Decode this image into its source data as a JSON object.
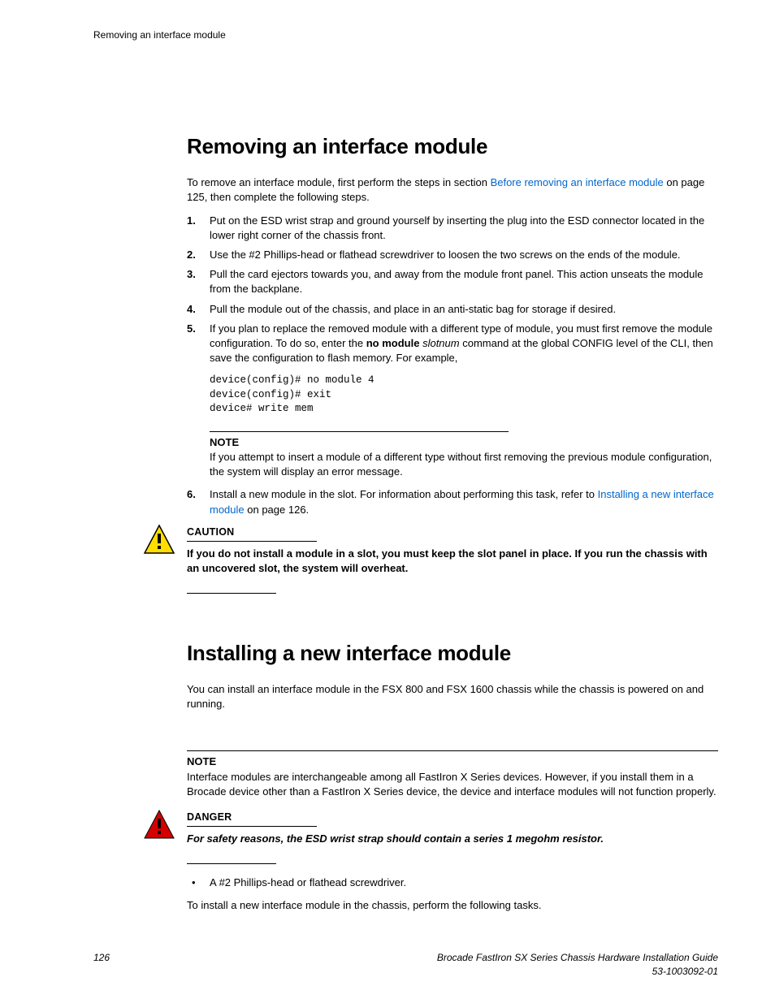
{
  "header": {
    "running": "Removing an interface module"
  },
  "section1": {
    "title": "Removing an interface module",
    "intro_a": "To remove an interface module, first perform the steps in section ",
    "intro_link": "Before removing an interface module",
    "intro_b": " on page 125, then complete the following steps.",
    "steps": [
      "Put on the ESD wrist strap and ground yourself by inserting the plug into the ESD connector located in the lower right corner of the chassis front.",
      "Use the #2 Phillips-head or flathead screwdriver to loosen the two screws on the ends of the module.",
      "Pull the card ejectors towards you, and away from the module front panel. This action unseats the module from the backplane.",
      "Pull the module out of the chassis, and place in an anti-static bag for storage if desired."
    ],
    "step5": {
      "a": "If you plan to replace the removed module with a different type of module, you must first remove the module configuration. To do so, enter the ",
      "bold": "no module",
      "ital": "slotnum",
      "b": " command at the global CONFIG level of the CLI, then save the configuration to flash memory. For example,"
    },
    "code": "device(config)# no module 4\ndevice(config)# exit\ndevice# write mem",
    "note1_label": "NOTE",
    "note1_body": "If you attempt to insert a module of a different type without first removing the previous module configuration, the system will display an error message.",
    "step6": {
      "a": "Install a new module in the slot. For information about performing this task, refer to ",
      "link": "Installing a new interface module",
      "b": " on page 126."
    },
    "caution_label": "CAUTION",
    "caution_text": "If you do not install a module in a slot, you must keep the slot panel in place. If you run the chassis with an uncovered slot, the system will overheat."
  },
  "section2": {
    "title": "Installing a new interface module",
    "intro": "You can install an interface module in the FSX 800 and FSX 1600 chassis while the chassis is powered on and running.",
    "note_label": "NOTE",
    "note_body": "Interface modules are interchangeable among all FastIron X Series devices. However, if you install them in a Brocade device other than a FastIron X Series device, the device and interface modules will not function properly.",
    "danger_label": "DANGER",
    "danger_text": "For safety reasons, the ESD wrist strap should contain a series 1 megohm resistor.",
    "bullet": "A #2 Phillips-head or flathead screwdriver.",
    "tail": "To install a new interface module in the chassis, perform the following tasks."
  },
  "footer": {
    "page": "126",
    "line1": "Brocade FastIron SX Series Chassis Hardware Installation Guide",
    "line2": "53-1003092-01"
  }
}
